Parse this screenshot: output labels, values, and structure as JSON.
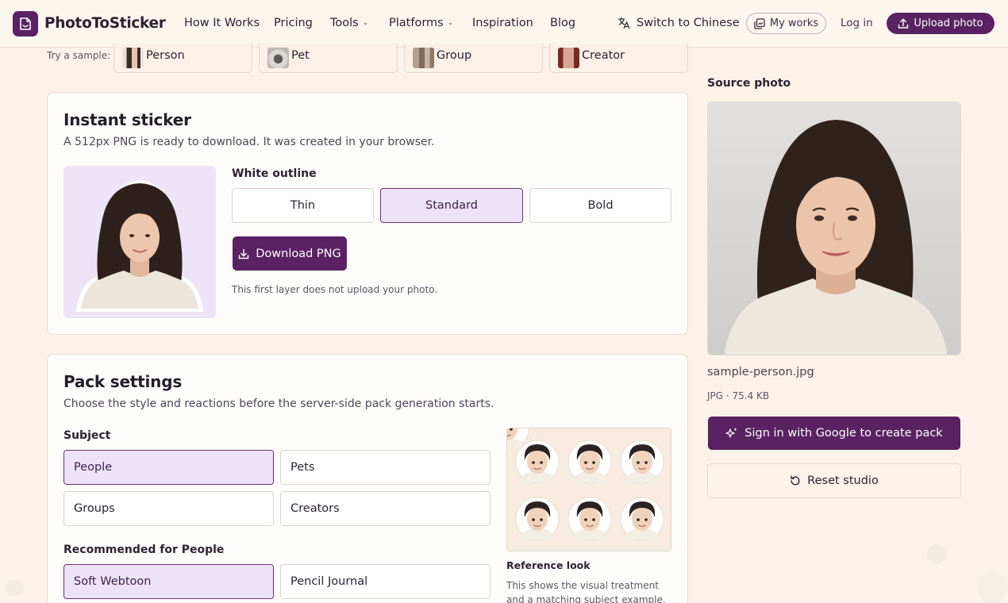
{
  "header": {
    "brand": "PhotoToSticker",
    "nav": [
      "How It Works",
      "Pricing",
      "Tools",
      "Platforms",
      "Inspiration",
      "Blog"
    ],
    "switch_language": "Switch to Chinese",
    "my_works": "My works",
    "login": "Log in",
    "upload": "Upload photo",
    "brand_color": "#5a2163"
  },
  "samples": {
    "label": "Try a sample:",
    "items": [
      "Person",
      "Pet",
      "Group",
      "Creator"
    ]
  },
  "instant": {
    "title": "Instant sticker",
    "subtitle": "A 512px PNG is ready to download. It was created in your browser.",
    "outline_label": "White outline",
    "outline_options": [
      "Thin",
      "Standard",
      "Bold"
    ],
    "outline_selected": "Standard",
    "download": "Download PNG",
    "note": "This first layer does not upload your photo."
  },
  "pack": {
    "title": "Pack settings",
    "subtitle": "Choose the style and reactions before the server-side pack generation starts.",
    "subject_label": "Subject",
    "subjects": [
      "People",
      "Pets",
      "Groups",
      "Creators"
    ],
    "subject_selected": "People",
    "recommended_label": "Recommended for People",
    "styles": [
      "Soft Webtoon",
      "Pencil Journal"
    ],
    "style_selected": "Soft Webtoon",
    "reference_title": "Reference look",
    "reference_desc": "This shows the visual treatment and a matching subject example, not the"
  },
  "source": {
    "title": "Source photo",
    "file_name": "sample-person.jpg",
    "file_meta": "JPG · 75.4 KB",
    "create_pack": "Sign in with Google to create pack",
    "reset": "Reset studio"
  }
}
